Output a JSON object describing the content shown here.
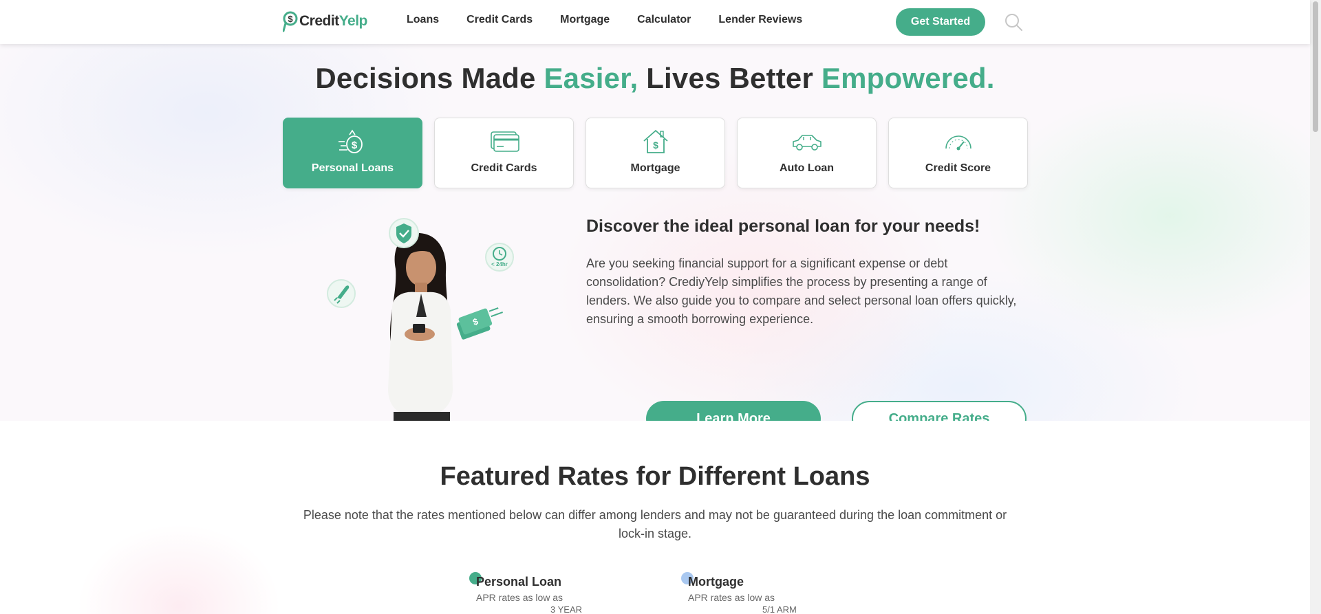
{
  "header": {
    "logo": {
      "part1": "Credit",
      "part2": "Yelp"
    },
    "nav": [
      "Loans",
      "Credit Cards",
      "Mortgage",
      "Calculator",
      "Lender Reviews"
    ],
    "cta_label": "Get Started",
    "search_icon": "search-icon"
  },
  "hero": {
    "title": {
      "part1": "Decisions Made ",
      "part2": "Easier,",
      "part3": " Lives Better ",
      "part4": "Empowered."
    },
    "tabs": [
      {
        "label": "Personal Loans",
        "icon": "money-bag-icon",
        "active": true
      },
      {
        "label": "Credit Cards",
        "icon": "credit-card-icon",
        "active": false
      },
      {
        "label": "Mortgage",
        "icon": "house-icon",
        "active": false
      },
      {
        "label": "Auto Loan",
        "icon": "car-icon",
        "active": false
      },
      {
        "label": "Credit Score",
        "icon": "gauge-icon",
        "active": false
      }
    ],
    "badge_24hr": "< 24hr",
    "heading": "Discover the ideal personal loan for your needs!",
    "description": "Are you seeking financial support for a significant expense or debt consolidation? CrediyYelp simplifies the process by presenting a range of lenders. We also guide you to compare and select personal loan offers quickly, ensuring a smooth borrowing experience.",
    "learn_more": "Learn More",
    "compare_rates": "Compare Rates"
  },
  "featured": {
    "title": "Featured Rates for Different Loans",
    "note": "Please note that the rates mentioned below can differ among lenders and may not be guaranteed during the loan commitment or lock-in stage.",
    "cards": [
      {
        "title": "Personal Loan",
        "sub": "APR rates as low as",
        "term": "3 YEAR",
        "dot_color": "#45ad8a",
        "value_color": "#45ad8a"
      },
      {
        "title": "Mortgage",
        "sub": "APR rates as low as",
        "term": "5/1 ARM",
        "dot_color": "#a9c8f0",
        "value_color": "#8fb5ea"
      }
    ]
  },
  "colors": {
    "accent": "#45ad8a",
    "text": "#2f2f2f"
  }
}
